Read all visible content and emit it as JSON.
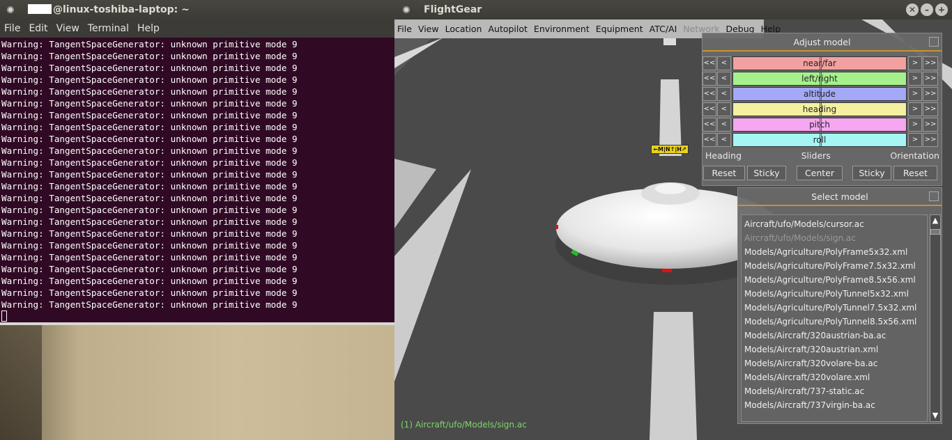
{
  "terminal": {
    "title_redacted": "",
    "title": "@linux-toshiba-laptop: ~",
    "menu": [
      "File",
      "Edit",
      "View",
      "Terminal",
      "Help"
    ],
    "lines": [
      "Warning: TangentSpaceGenerator: unknown primitive mode 9",
      "Warning: TangentSpaceGenerator: unknown primitive mode 9",
      "Warning: TangentSpaceGenerator: unknown primitive mode 9",
      "Warning: TangentSpaceGenerator: unknown primitive mode 9",
      "Warning: TangentSpaceGenerator: unknown primitive mode 9",
      "Warning: TangentSpaceGenerator: unknown primitive mode 9",
      "Warning: TangentSpaceGenerator: unknown primitive mode 9",
      "Warning: TangentSpaceGenerator: unknown primitive mode 9",
      "Warning: TangentSpaceGenerator: unknown primitive mode 9",
      "Warning: TangentSpaceGenerator: unknown primitive mode 9",
      "Warning: TangentSpaceGenerator: unknown primitive mode 9",
      "Warning: TangentSpaceGenerator: unknown primitive mode 9",
      "Warning: TangentSpaceGenerator: unknown primitive mode 9",
      "Warning: TangentSpaceGenerator: unknown primitive mode 9",
      "Warning: TangentSpaceGenerator: unknown primitive mode 9",
      "Warning: TangentSpaceGenerator: unknown primitive mode 9",
      "Warning: TangentSpaceGenerator: unknown primitive mode 9",
      "Warning: TangentSpaceGenerator: unknown primitive mode 9",
      "Warning: TangentSpaceGenerator: unknown primitive mode 9",
      "Warning: TangentSpaceGenerator: unknown primitive mode 9",
      "Warning: TangentSpaceGenerator: unknown primitive mode 9",
      "Warning: TangentSpaceGenerator: unknown primitive mode 9",
      "Warning: TangentSpaceGenerator: unknown primitive mode 9"
    ]
  },
  "flightgear": {
    "title": "FlightGear",
    "window_buttons": {
      "close": "✕",
      "minimize": "–",
      "maximize": "+"
    },
    "menu": [
      "File",
      "View",
      "Location",
      "Autopilot",
      "Environment",
      "Equipment",
      "ATC/AI",
      "Network",
      "Debug",
      "Help"
    ],
    "menu_disabled": [
      "Network"
    ],
    "runway_sign": "←M|N↑|H↗",
    "status": "(1)  Aircraft/ufo/Models/sign.ac"
  },
  "adjust_model": {
    "title": "Adjust model",
    "step_buttons": {
      "fast_back": "<<",
      "back": "<",
      "forward": ">",
      "fast_forward": ">>"
    },
    "sliders": [
      {
        "label": "near/far",
        "color": "#f2a0a0"
      },
      {
        "label": "left/right",
        "color": "#a6f08c"
      },
      {
        "label": "altitude",
        "color": "#a3a8f7"
      },
      {
        "label": "heading",
        "color": "#f5f0a0"
      },
      {
        "label": "pitch",
        "color": "#f7a6f2"
      },
      {
        "label": "roll",
        "color": "#a6f5f5"
      }
    ],
    "section_labels": {
      "left": "Heading",
      "center": "Sliders",
      "right": "Orientation"
    },
    "buttons": {
      "reset_left": "Reset",
      "sticky_left": "Sticky",
      "center": "Center",
      "sticky_right": "Sticky",
      "reset_right": "Reset"
    }
  },
  "select_model": {
    "title": "Select model",
    "items": [
      {
        "label": "Aircraft/ufo/Models/cursor.ac",
        "selected": false
      },
      {
        "label": "Aircraft/ufo/Models/sign.ac",
        "selected": true
      },
      {
        "label": "Models/Agriculture/PolyFrame5x32.xml",
        "selected": false
      },
      {
        "label": "Models/Agriculture/PolyFrame7.5x32.xml",
        "selected": false
      },
      {
        "label": "Models/Agriculture/PolyFrame8.5x56.xml",
        "selected": false
      },
      {
        "label": "Models/Agriculture/PolyTunnel5x32.xml",
        "selected": false
      },
      {
        "label": "Models/Agriculture/PolyTunnel7.5x32.xml",
        "selected": false
      },
      {
        "label": "Models/Agriculture/PolyTunnel8.5x56.xml",
        "selected": false
      },
      {
        "label": "Models/Aircraft/320austrian-ba.ac",
        "selected": false
      },
      {
        "label": "Models/Aircraft/320austrian.xml",
        "selected": false
      },
      {
        "label": "Models/Aircraft/320volare-ba.ac",
        "selected": false
      },
      {
        "label": "Models/Aircraft/320volare.xml",
        "selected": false
      },
      {
        "label": "Models/Aircraft/737-static.ac",
        "selected": false
      },
      {
        "label": "Models/Aircraft/737virgin-ba.ac",
        "selected": false
      }
    ],
    "scroll_up": "▲",
    "scroll_down": "▼"
  }
}
